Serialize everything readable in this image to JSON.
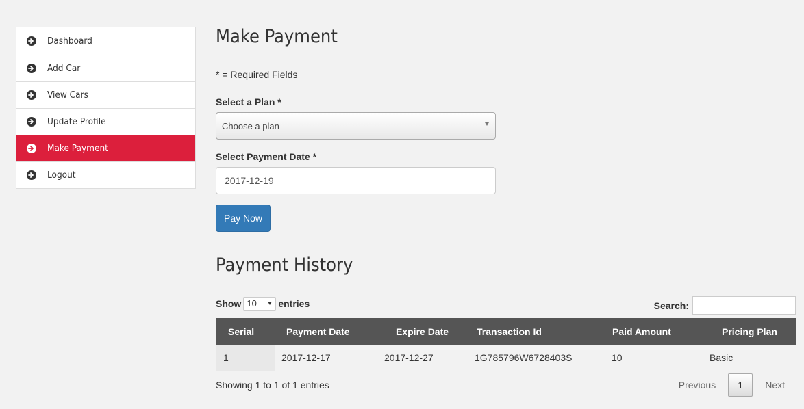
{
  "sidebar": {
    "items": [
      {
        "label": "Dashboard",
        "icon": "arrow-circle-right-icon",
        "active": false
      },
      {
        "label": "Add Car",
        "icon": "arrow-circle-right-icon",
        "active": false
      },
      {
        "label": "View Cars",
        "icon": "arrow-circle-right-icon",
        "active": false
      },
      {
        "label": "Update Profile",
        "icon": "arrow-circle-right-icon",
        "active": false
      },
      {
        "label": "Make Payment",
        "icon": "arrow-circle-right-icon",
        "active": true
      },
      {
        "label": "Logout",
        "icon": "arrow-circle-right-icon",
        "active": false
      }
    ],
    "active_color": "#dc1f3c"
  },
  "payment_form": {
    "title": "Make Payment",
    "required_note": "* = Required Fields",
    "plan_label": "Select a Plan *",
    "plan_value": "Choose a plan",
    "date_label": "Select Payment Date *",
    "date_value": "2017-12-19",
    "submit_label": "Pay Now",
    "submit_color": "#337ab7"
  },
  "history": {
    "title": "Payment History",
    "show_label": "Show",
    "entries_value": "10",
    "entries_label": "entries",
    "search_label": "Search:",
    "search_value": "",
    "columns": [
      "Serial",
      "Payment Date",
      "Expire Date",
      "Transaction Id",
      "Paid Amount",
      "Pricing Plan"
    ],
    "rows": [
      [
        "1",
        "2017-12-17",
        "2017-12-27",
        "1G785796W6728403S",
        "10",
        "Basic"
      ]
    ],
    "info": "Showing 1 to 1 of 1 entries",
    "pagination": {
      "previous": "Previous",
      "current": "1",
      "next": "Next"
    },
    "header_color": "#555555"
  }
}
